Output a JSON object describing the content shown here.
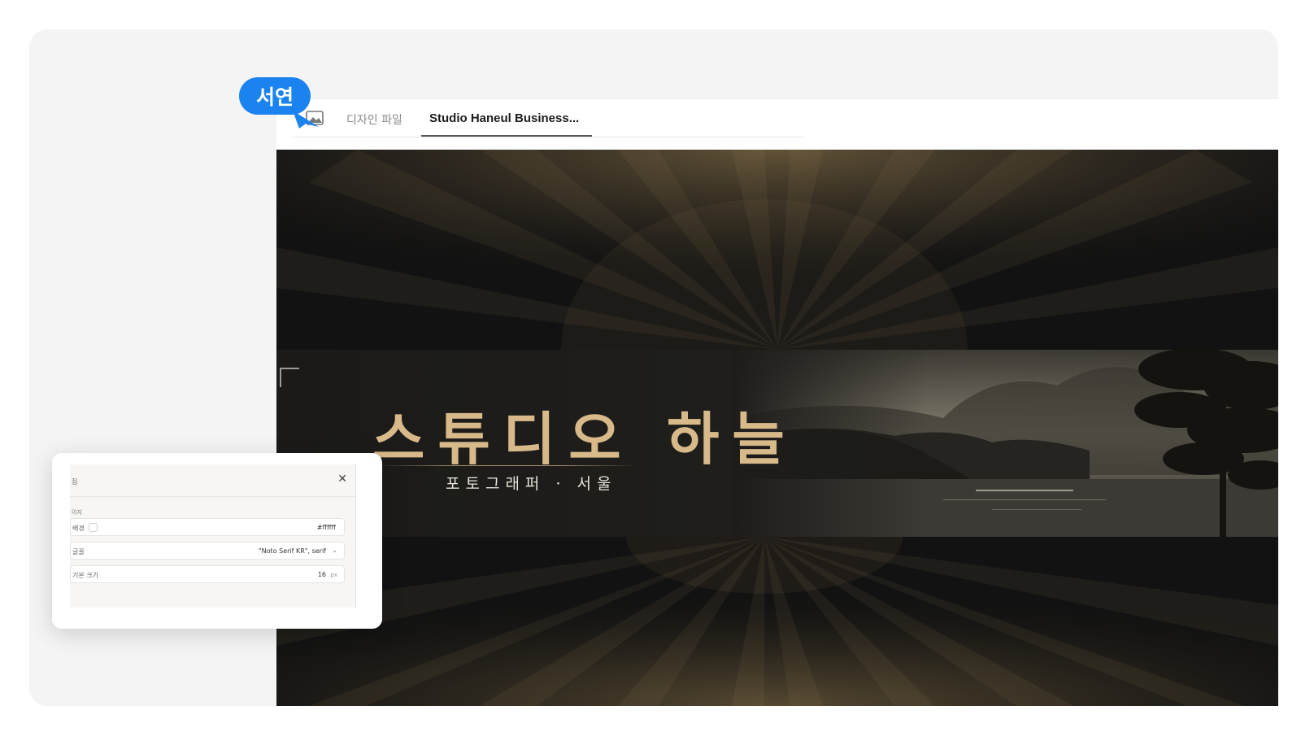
{
  "app": {
    "tabs": [
      {
        "label": "디자인 파일",
        "active": false
      },
      {
        "label": "Studio Haneul Business...",
        "active": true
      }
    ]
  },
  "user_bubble": {
    "name": "서연",
    "color": "#1a83f0"
  },
  "banner": {
    "title": "스튜디오 하늘",
    "subtitle": "포토그래퍼 · 서울",
    "accent_color": "#d8b98a",
    "background_color": "#121212"
  },
  "properties_panel": {
    "title": "집",
    "close_icon": "close-icon",
    "section_label": "이지",
    "fields": {
      "background": {
        "label": "배경",
        "value": "#ffffff"
      },
      "font": {
        "label": "글꼴",
        "value": "\"Noto Serif KR\", serif"
      },
      "base_size": {
        "label": "기본 크기",
        "value": "16",
        "unit": "px"
      }
    }
  }
}
